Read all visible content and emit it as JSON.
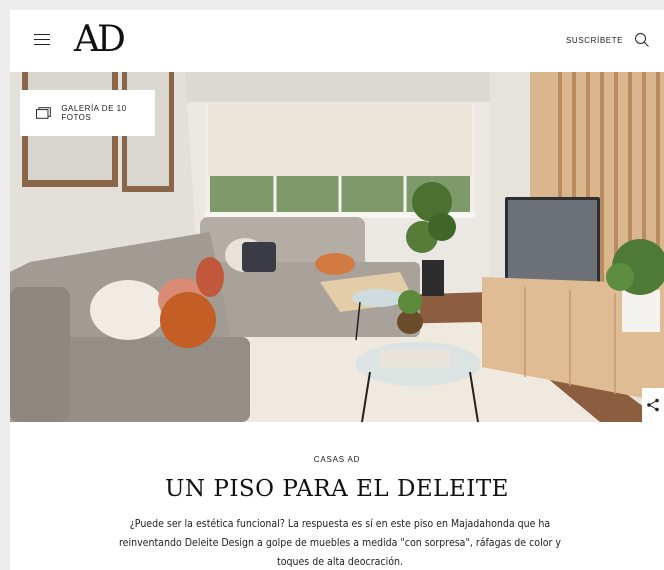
{
  "header": {
    "logo": "AD",
    "subscribe_label": "SUSCRÍBETE",
    "menu_icon": "hamburger-menu-icon",
    "search_icon": "search-icon"
  },
  "hero": {
    "gallery_label": "GALERÍA DE 10 FOTOS",
    "gallery_icon": "gallery-stack-icon",
    "share_icon": "share-icon"
  },
  "article": {
    "section": "CASAS AD",
    "title": "UN PISO PARA EL DELEITE",
    "dek": "¿Puede ser la estética funcional? La respuesta es sí en este piso en Majadahonda que ha reinventando Deleite Design a golpe de muebles a medida \"con sorpresa\", ráfagas de color y toques de alta deocración."
  },
  "colors": {
    "wall": "#e9e6e2",
    "wood": "#d6b28a",
    "sofa": "#a39d97",
    "floor": "#8a5a3c"
  }
}
